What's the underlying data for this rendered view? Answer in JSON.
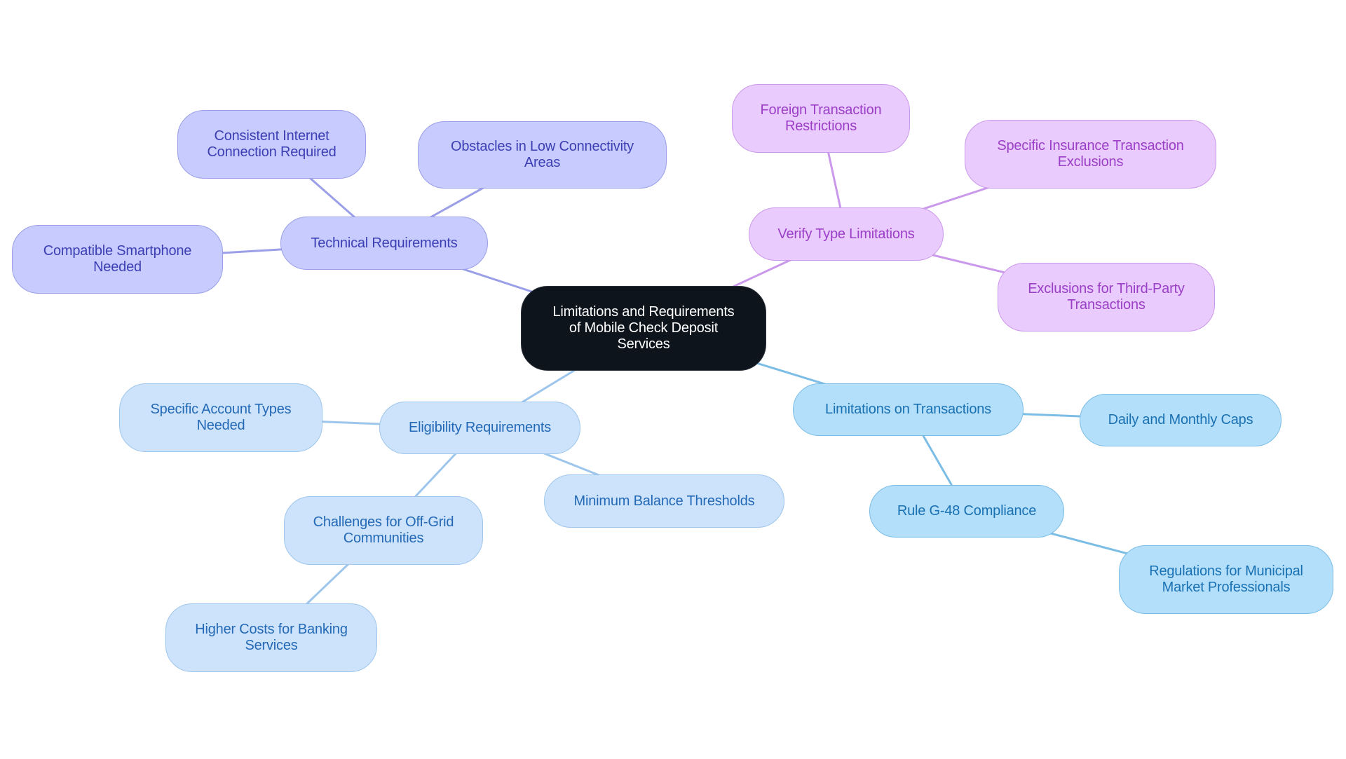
{
  "diagram": {
    "type": "mindmap",
    "root": {
      "id": "root",
      "label": "Limitations and Requirements\nof Mobile Check Deposit\nServices"
    },
    "branches": [
      {
        "id": "tech",
        "label": "Technical Requirements",
        "color": "#9a9fe8",
        "children": [
          {
            "id": "tech-1",
            "label": "Consistent Internet\nConnection Required"
          },
          {
            "id": "tech-2",
            "label": "Obstacles in Low Connectivity\nAreas"
          },
          {
            "id": "tech-3",
            "label": "Compatible Smartphone\nNeeded"
          }
        ]
      },
      {
        "id": "verify",
        "label": "Verify Type Limitations",
        "color": "#cb99ec",
        "children": [
          {
            "id": "verify-1",
            "label": "Foreign Transaction\nRestrictions"
          },
          {
            "id": "verify-2",
            "label": "Specific Insurance Transaction\nExclusions"
          },
          {
            "id": "verify-3",
            "label": "Exclusions for Third-Party\nTransactions"
          }
        ]
      },
      {
        "id": "limit",
        "label": "Limitations on Transactions",
        "color": "#7cbde6",
        "children": [
          {
            "id": "limit-1",
            "label": "Daily and Monthly Caps"
          },
          {
            "id": "limit-2",
            "label": "Rule G-48 Compliance",
            "children": [
              {
                "id": "limit-2-1",
                "label": "Regulations for Municipal\nMarket Professionals"
              }
            ]
          }
        ]
      },
      {
        "id": "elig",
        "label": "Eligibility Requirements",
        "color": "#9ec6ec",
        "children": [
          {
            "id": "elig-1",
            "label": "Specific Account Types\nNeeded"
          },
          {
            "id": "elig-2",
            "label": "Minimum Balance Thresholds"
          },
          {
            "id": "elig-3",
            "label": "Challenges for Off-Grid\nCommunities",
            "children": [
              {
                "id": "elig-3-1",
                "label": "Higher Costs for Banking\nServices"
              }
            ]
          }
        ]
      }
    ],
    "colors": {
      "root_fill": "#0d141b",
      "technical_fill": "#c7cbfd",
      "verify_fill": "#eacbfd",
      "limitations_fill": "#b3dffb",
      "eligibility_fill": "#cde3fb"
    }
  }
}
